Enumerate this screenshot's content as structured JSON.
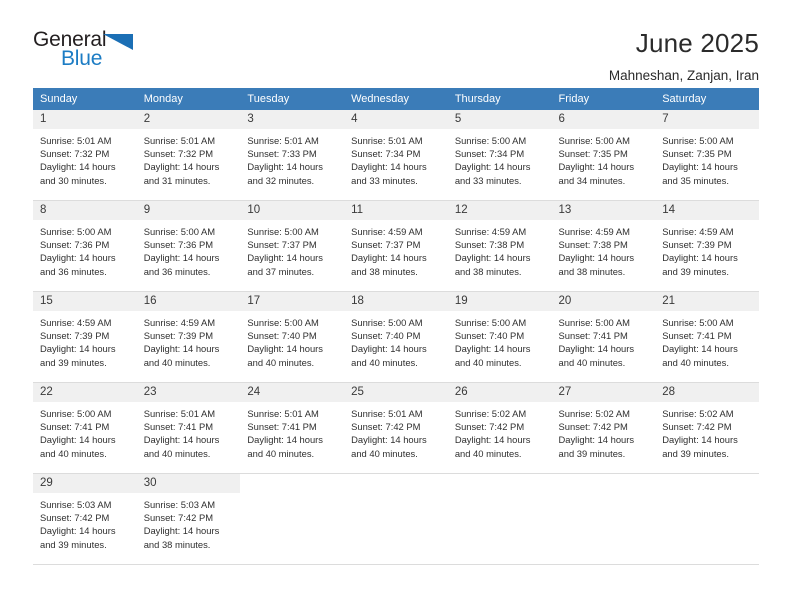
{
  "logo": {
    "word_top": "General",
    "word_bottom": "Blue",
    "triangle_color": "#1b6fb5",
    "blue_color": "#1c7cc4"
  },
  "header": {
    "title": "June 2025",
    "subtitle": "Mahneshan, Zanjan, Iran"
  },
  "theme": {
    "header_bg": "#3b7cb8",
    "daynum_bg": "#f0f0f0",
    "border": "#dcdcdc"
  },
  "weekday_headers": [
    "Sunday",
    "Monday",
    "Tuesday",
    "Wednesday",
    "Thursday",
    "Friday",
    "Saturday"
  ],
  "weeks": [
    [
      {
        "day": "1",
        "sunrise": "Sunrise: 5:01 AM",
        "sunset": "Sunset: 7:32 PM",
        "daylight_1": "Daylight: 14 hours",
        "daylight_2": "and 30 minutes."
      },
      {
        "day": "2",
        "sunrise": "Sunrise: 5:01 AM",
        "sunset": "Sunset: 7:32 PM",
        "daylight_1": "Daylight: 14 hours",
        "daylight_2": "and 31 minutes."
      },
      {
        "day": "3",
        "sunrise": "Sunrise: 5:01 AM",
        "sunset": "Sunset: 7:33 PM",
        "daylight_1": "Daylight: 14 hours",
        "daylight_2": "and 32 minutes."
      },
      {
        "day": "4",
        "sunrise": "Sunrise: 5:01 AM",
        "sunset": "Sunset: 7:34 PM",
        "daylight_1": "Daylight: 14 hours",
        "daylight_2": "and 33 minutes."
      },
      {
        "day": "5",
        "sunrise": "Sunrise: 5:00 AM",
        "sunset": "Sunset: 7:34 PM",
        "daylight_1": "Daylight: 14 hours",
        "daylight_2": "and 33 minutes."
      },
      {
        "day": "6",
        "sunrise": "Sunrise: 5:00 AM",
        "sunset": "Sunset: 7:35 PM",
        "daylight_1": "Daylight: 14 hours",
        "daylight_2": "and 34 minutes."
      },
      {
        "day": "7",
        "sunrise": "Sunrise: 5:00 AM",
        "sunset": "Sunset: 7:35 PM",
        "daylight_1": "Daylight: 14 hours",
        "daylight_2": "and 35 minutes."
      }
    ],
    [
      {
        "day": "8",
        "sunrise": "Sunrise: 5:00 AM",
        "sunset": "Sunset: 7:36 PM",
        "daylight_1": "Daylight: 14 hours",
        "daylight_2": "and 36 minutes."
      },
      {
        "day": "9",
        "sunrise": "Sunrise: 5:00 AM",
        "sunset": "Sunset: 7:36 PM",
        "daylight_1": "Daylight: 14 hours",
        "daylight_2": "and 36 minutes."
      },
      {
        "day": "10",
        "sunrise": "Sunrise: 5:00 AM",
        "sunset": "Sunset: 7:37 PM",
        "daylight_1": "Daylight: 14 hours",
        "daylight_2": "and 37 minutes."
      },
      {
        "day": "11",
        "sunrise": "Sunrise: 4:59 AM",
        "sunset": "Sunset: 7:37 PM",
        "daylight_1": "Daylight: 14 hours",
        "daylight_2": "and 38 minutes."
      },
      {
        "day": "12",
        "sunrise": "Sunrise: 4:59 AM",
        "sunset": "Sunset: 7:38 PM",
        "daylight_1": "Daylight: 14 hours",
        "daylight_2": "and 38 minutes."
      },
      {
        "day": "13",
        "sunrise": "Sunrise: 4:59 AM",
        "sunset": "Sunset: 7:38 PM",
        "daylight_1": "Daylight: 14 hours",
        "daylight_2": "and 38 minutes."
      },
      {
        "day": "14",
        "sunrise": "Sunrise: 4:59 AM",
        "sunset": "Sunset: 7:39 PM",
        "daylight_1": "Daylight: 14 hours",
        "daylight_2": "and 39 minutes."
      }
    ],
    [
      {
        "day": "15",
        "sunrise": "Sunrise: 4:59 AM",
        "sunset": "Sunset: 7:39 PM",
        "daylight_1": "Daylight: 14 hours",
        "daylight_2": "and 39 minutes."
      },
      {
        "day": "16",
        "sunrise": "Sunrise: 4:59 AM",
        "sunset": "Sunset: 7:39 PM",
        "daylight_1": "Daylight: 14 hours",
        "daylight_2": "and 40 minutes."
      },
      {
        "day": "17",
        "sunrise": "Sunrise: 5:00 AM",
        "sunset": "Sunset: 7:40 PM",
        "daylight_1": "Daylight: 14 hours",
        "daylight_2": "and 40 minutes."
      },
      {
        "day": "18",
        "sunrise": "Sunrise: 5:00 AM",
        "sunset": "Sunset: 7:40 PM",
        "daylight_1": "Daylight: 14 hours",
        "daylight_2": "and 40 minutes."
      },
      {
        "day": "19",
        "sunrise": "Sunrise: 5:00 AM",
        "sunset": "Sunset: 7:40 PM",
        "daylight_1": "Daylight: 14 hours",
        "daylight_2": "and 40 minutes."
      },
      {
        "day": "20",
        "sunrise": "Sunrise: 5:00 AM",
        "sunset": "Sunset: 7:41 PM",
        "daylight_1": "Daylight: 14 hours",
        "daylight_2": "and 40 minutes."
      },
      {
        "day": "21",
        "sunrise": "Sunrise: 5:00 AM",
        "sunset": "Sunset: 7:41 PM",
        "daylight_1": "Daylight: 14 hours",
        "daylight_2": "and 40 minutes."
      }
    ],
    [
      {
        "day": "22",
        "sunrise": "Sunrise: 5:00 AM",
        "sunset": "Sunset: 7:41 PM",
        "daylight_1": "Daylight: 14 hours",
        "daylight_2": "and 40 minutes."
      },
      {
        "day": "23",
        "sunrise": "Sunrise: 5:01 AM",
        "sunset": "Sunset: 7:41 PM",
        "daylight_1": "Daylight: 14 hours",
        "daylight_2": "and 40 minutes."
      },
      {
        "day": "24",
        "sunrise": "Sunrise: 5:01 AM",
        "sunset": "Sunset: 7:41 PM",
        "daylight_1": "Daylight: 14 hours",
        "daylight_2": "and 40 minutes."
      },
      {
        "day": "25",
        "sunrise": "Sunrise: 5:01 AM",
        "sunset": "Sunset: 7:42 PM",
        "daylight_1": "Daylight: 14 hours",
        "daylight_2": "and 40 minutes."
      },
      {
        "day": "26",
        "sunrise": "Sunrise: 5:02 AM",
        "sunset": "Sunset: 7:42 PM",
        "daylight_1": "Daylight: 14 hours",
        "daylight_2": "and 40 minutes."
      },
      {
        "day": "27",
        "sunrise": "Sunrise: 5:02 AM",
        "sunset": "Sunset: 7:42 PM",
        "daylight_1": "Daylight: 14 hours",
        "daylight_2": "and 39 minutes."
      },
      {
        "day": "28",
        "sunrise": "Sunrise: 5:02 AM",
        "sunset": "Sunset: 7:42 PM",
        "daylight_1": "Daylight: 14 hours",
        "daylight_2": "and 39 minutes."
      }
    ],
    [
      {
        "day": "29",
        "sunrise": "Sunrise: 5:03 AM",
        "sunset": "Sunset: 7:42 PM",
        "daylight_1": "Daylight: 14 hours",
        "daylight_2": "and 39 minutes."
      },
      {
        "day": "30",
        "sunrise": "Sunrise: 5:03 AM",
        "sunset": "Sunset: 7:42 PM",
        "daylight_1": "Daylight: 14 hours",
        "daylight_2": "and 38 minutes."
      },
      null,
      null,
      null,
      null,
      null
    ]
  ]
}
